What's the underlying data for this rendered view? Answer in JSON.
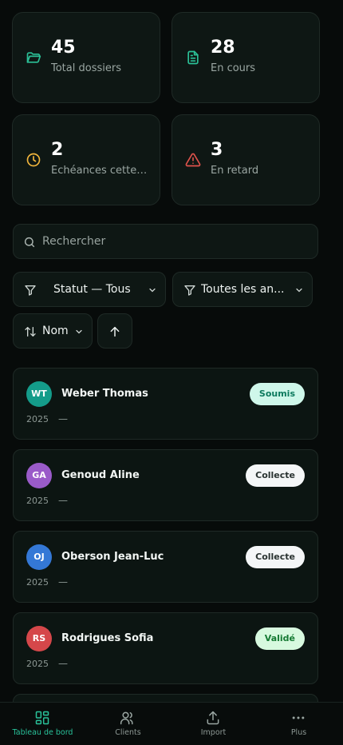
{
  "stats": [
    {
      "value": "45",
      "label": "Total dossiers",
      "icon": "folder-icon",
      "color": "#2bbf96"
    },
    {
      "value": "28",
      "label": "En cours",
      "icon": "document-icon",
      "color": "#2bbf96"
    },
    {
      "value": "2",
      "label": "Échéances cette s...",
      "icon": "clock-icon",
      "color": "#f1b53c"
    },
    {
      "value": "3",
      "label": "En retard",
      "icon": "warning-icon",
      "color": "#e0534c"
    }
  ],
  "search": {
    "placeholder": "Rechercher"
  },
  "filters": {
    "status": "Statut — Tous",
    "years": "Toutes les an...",
    "sort": "Nom"
  },
  "clients": [
    {
      "initials": "WT",
      "name": "Weber Thomas",
      "year": "2025",
      "detail": "—",
      "status": "Soumis",
      "avatar_color": "#149c8a",
      "badge_bg": "#cff7ea",
      "badge_fg": "#0d7a5e"
    },
    {
      "initials": "GA",
      "name": "Genoud Aline",
      "year": "2025",
      "detail": "—",
      "status": "Collecte",
      "avatar_color": "#9a5bc9",
      "badge_bg": "#f4f6f7",
      "badge_fg": "#2a3331"
    },
    {
      "initials": "OJ",
      "name": "Oberson Jean-Luc",
      "year": "2025",
      "detail": "—",
      "status": "Collecte",
      "avatar_color": "#3478d6",
      "badge_bg": "#f4f6f7",
      "badge_fg": "#2a3331"
    },
    {
      "initials": "RS",
      "name": "Rodrigues Sofia",
      "year": "2025",
      "detail": "—",
      "status": "Validé",
      "avatar_color": "#d5474a",
      "badge_bg": "#d7f9df",
      "badge_fg": "#157a33"
    }
  ],
  "tabs": [
    {
      "label": "Tableau de bord",
      "icon": "dashboard-icon",
      "active": true
    },
    {
      "label": "Clients",
      "icon": "users-icon",
      "active": false
    },
    {
      "label": "Import",
      "icon": "upload-icon",
      "active": false
    },
    {
      "label": "Plus",
      "icon": "more-icon",
      "active": false
    }
  ]
}
